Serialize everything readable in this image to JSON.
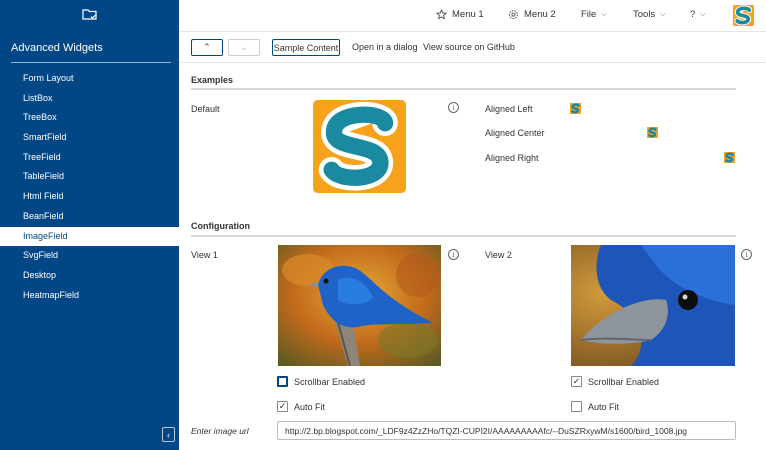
{
  "sidebar": {
    "title": "Advanced Widgets",
    "items": [
      {
        "label": "Form Layout"
      },
      {
        "label": "ListBox"
      },
      {
        "label": "TreeBox"
      },
      {
        "label": "SmartField"
      },
      {
        "label": "TreeField"
      },
      {
        "label": "TableField"
      },
      {
        "label": "Html Field"
      },
      {
        "label": "BeanField"
      },
      {
        "label": "ImageField",
        "active": true
      },
      {
        "label": "SvgField"
      },
      {
        "label": "Desktop"
      },
      {
        "label": "HeatmapField"
      }
    ],
    "collapse_glyph": "‹"
  },
  "header": {
    "menu1": "Menu 1",
    "menu2": "Menu 2",
    "file": "File",
    "tools": "Tools",
    "help": "?",
    "chevron": "⌵"
  },
  "toolbar": {
    "up_glyph": "⌃",
    "down_glyph": "⌄",
    "sample_content": "Sample Content",
    "open_dialog": "Open in a dialog",
    "view_source": "View source on GitHub"
  },
  "examples": {
    "title": "Examples",
    "default_label": "Default",
    "aligned_left": "Aligned Left",
    "aligned_center": "Aligned Center",
    "aligned_right": "Aligned Right"
  },
  "configuration": {
    "title": "Configuration",
    "view1_label": "View 1",
    "view2_label": "View 2",
    "view1": {
      "scrollbar_label": "Scrollbar Enabled",
      "scrollbar_checked": false,
      "autofit_label": "Auto Fit",
      "autofit_checked": true
    },
    "view2": {
      "scrollbar_label": "Scrollbar Enabled",
      "scrollbar_checked": true,
      "autofit_label": "Auto Fit",
      "autofit_checked": false
    },
    "url_label": "Enter image url",
    "url_value": "http://2.bp.blogspot.com/_LDF9z4ZzZHo/TQZI-CUPI2I/AAAAAAAAAfc/--DuSZRxywM/s1600/bird_1008.jpg"
  },
  "info_glyph": "i",
  "check_glyph": "✓",
  "colors": {
    "brand": "#014786",
    "logo_orange": "#f7a21b",
    "logo_teal": "#1a8aa0"
  }
}
